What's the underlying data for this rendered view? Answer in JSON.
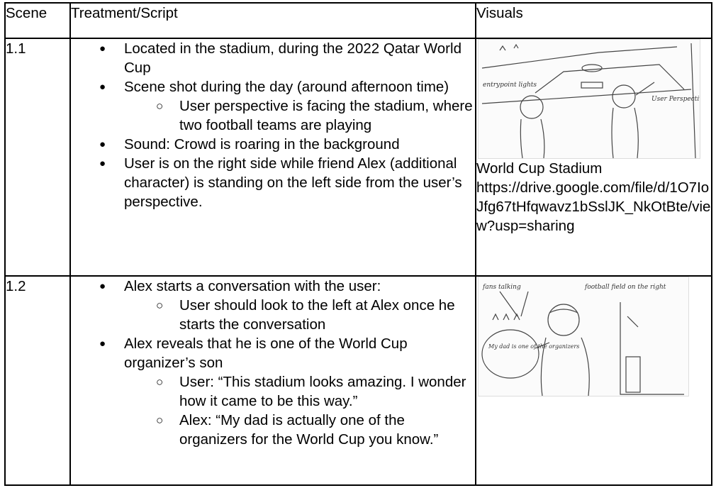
{
  "headers": {
    "scene": "Scene",
    "treatment": "Treatment/Script",
    "visuals": "Visuals"
  },
  "rows": [
    {
      "scene": "1.1",
      "bullets": [
        "Located in the stadium, during the 2022 Qatar World Cup",
        "Scene shot during the day (around afternoon time)",
        "User perspective is facing the stadium, where two football teams are playing",
        "Sound: Crowd is roaring in the background",
        "User is on the right side while friend Alex (additional character) is standing on the left side from the user’s perspective."
      ],
      "sketch_labels": [
        "entrypoint lights",
        "User Perspective"
      ],
      "caption_title": "World Cup Stadium",
      "caption_link": "https://drive.google.com/file/d/1O7IoJfg67tHfqwavz1bSslJK_NkOtBte/view?usp=sharing"
    },
    {
      "scene": "1.2",
      "bullets": [
        "Alex starts a conversation with the user:",
        "User should look to the left at Alex once he starts the conversation",
        "Alex reveals that he is one of the World Cup organizer’s son",
        "User: “This stadium looks amazing. I wonder how it came to be this way.”",
        "Alex: “My dad is actually one of the organizers for the World Cup you know.”"
      ],
      "sketch_labels": [
        "fans talking",
        "football field on the right",
        "My dad is one of the organizers"
      ]
    }
  ]
}
